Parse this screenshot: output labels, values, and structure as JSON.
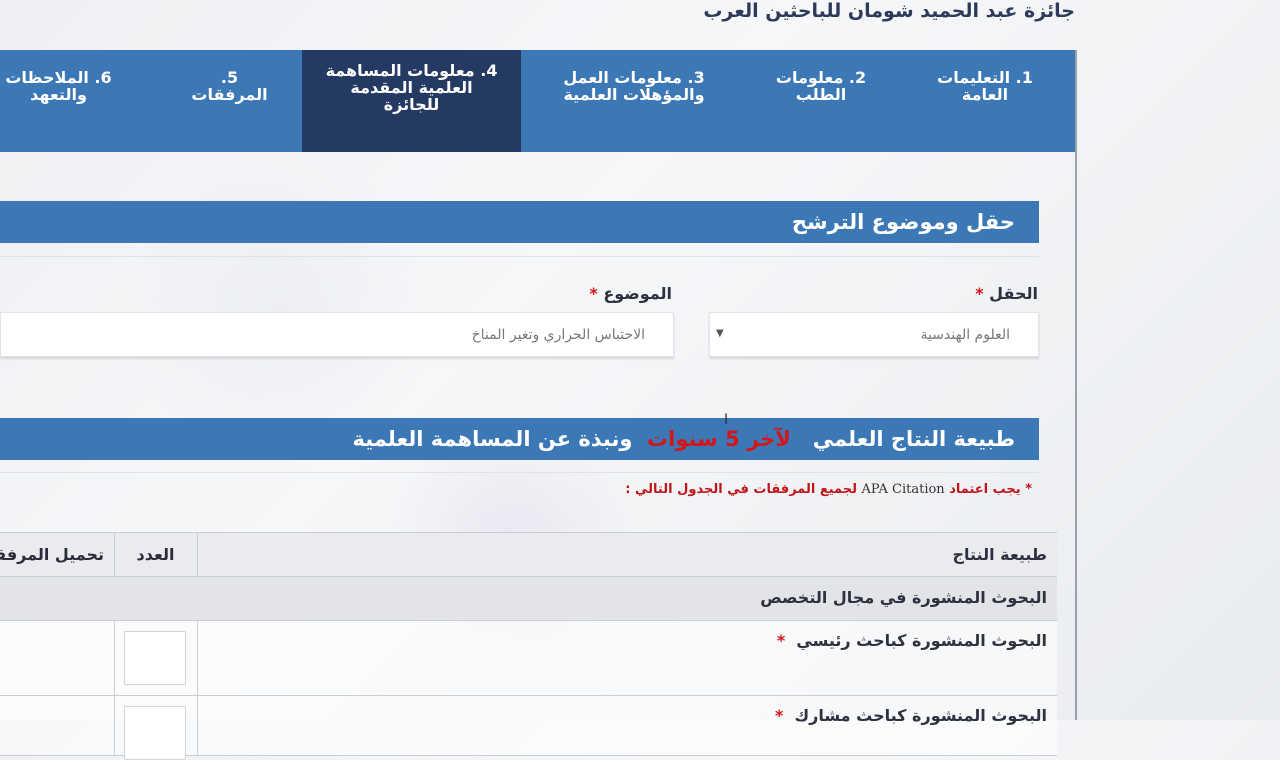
{
  "page": {
    "title": "جائزة عبد الحميد شومان للباحثين العرب"
  },
  "tabs": [
    {
      "label": "1. التعليمات العامة",
      "line1": "1. التعليمات",
      "line2": "العامة"
    },
    {
      "label": "2. معلومات الطلب",
      "line1": "2. معلومات",
      "line2": "الطلب"
    },
    {
      "label": "3. معلومات العمل والمؤهلات العلمية",
      "line1": "3. معلومات العمل",
      "line2": "والمؤهلات العلمية"
    },
    {
      "label": "4. معلومات المساهمة العلمية المقدمة للجائزة",
      "line1": "4. معلومات المساهمة",
      "line2": "العلمية المقدمة",
      "line3": "للجائزة"
    },
    {
      "label": "5. المرفقات",
      "line1": "5.",
      "line2": "المرفقات"
    },
    {
      "label": "6. الملاحظات والتعهد",
      "line1": "6. الملاحظات",
      "line2": "والتعهد"
    }
  ],
  "section1": {
    "title": "حقل وموضوع الترشح"
  },
  "field": {
    "label": "الحقل",
    "required": "*",
    "value": "العلوم الهندسية",
    "caret": "▼"
  },
  "topic": {
    "label": "الموضوع",
    "required": "*",
    "value": "الاحتباس الحراري وتغير المناخ"
  },
  "section2": {
    "title_part1": "طبيعة النتاج العلمي",
    "title_red": "لآخر 5 سنوات",
    "title_part2": "ونبذة عن المساهمة العلمية"
  },
  "note": {
    "star": "*",
    "part1": "يجب اعتماد",
    "apa": "APA Citation",
    "part2": "لجميع المرفقات في الجدول التالي :"
  },
  "table": {
    "headers": {
      "nature": "طبيعة النتاج",
      "count": "العدد",
      "upload": "تحميل المرفقات"
    },
    "group": "البحوث المنشورة في مجال التخصص",
    "rows": [
      {
        "label": "البحوث المنشورة كباحث رئيسي",
        "required": "*"
      },
      {
        "label": "البحوث المنشورة كباحث مشارك",
        "required": "*"
      }
    ]
  }
}
